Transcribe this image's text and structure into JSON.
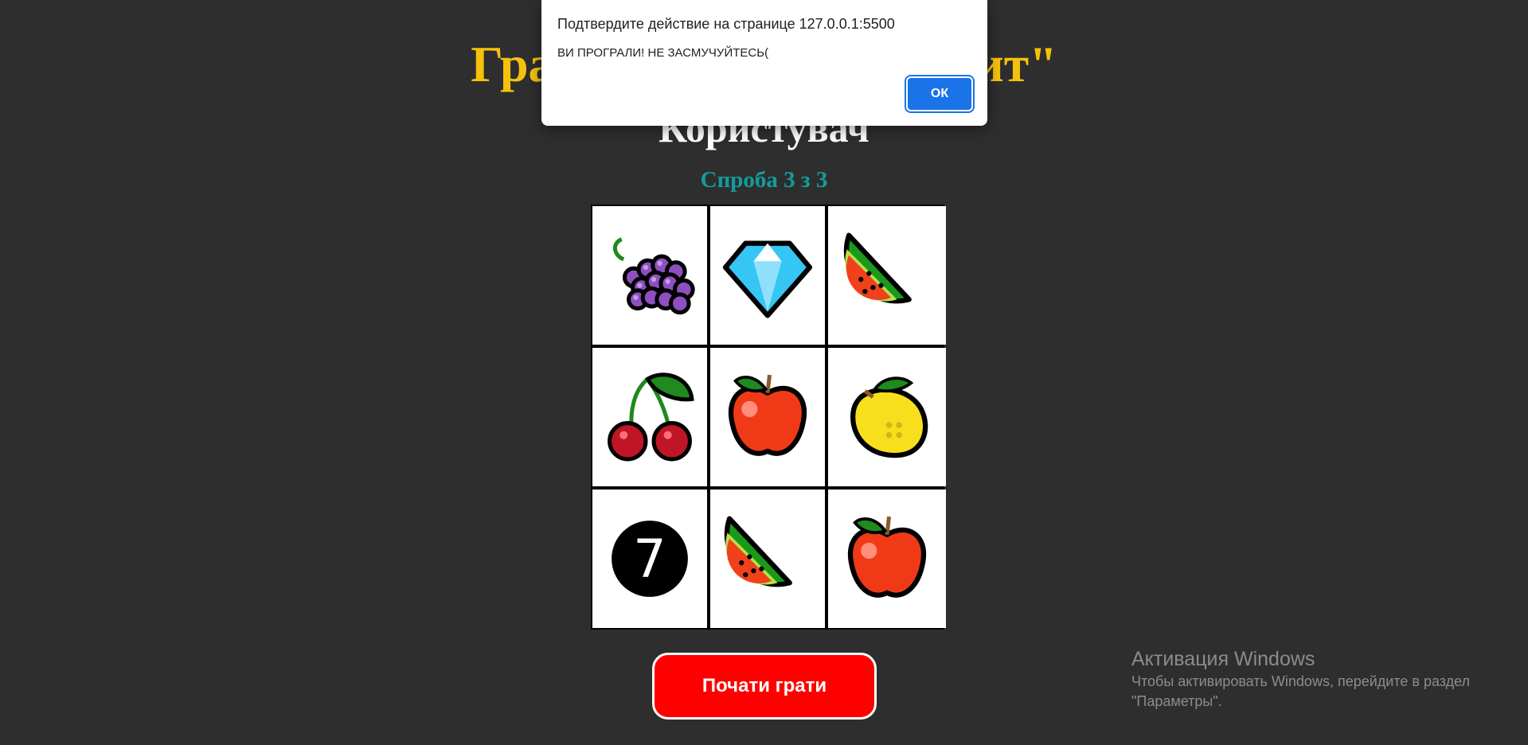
{
  "game": {
    "title": "Гра \"Однорукий бандит\"",
    "player_name": "Користувач",
    "attempt_text": "Спроба 3 з 3",
    "play_button_label": "Почати грати",
    "reels": [
      [
        "grapes-icon",
        "diamond-icon",
        "watermelon-icon"
      ],
      [
        "cherries-icon",
        "apple-icon",
        "lemon-icon"
      ],
      [
        "seven-icon",
        "watermelon-icon",
        "apple-icon"
      ]
    ],
    "seven_label": "7"
  },
  "dialog": {
    "title": "Подтвердите действие на странице 127.0.0.1:5500",
    "message": "ВИ ПРОГРАЛИ! НЕ ЗАСМУЧУЙТЕСЬ(",
    "ok_label": "ОК"
  },
  "windows_activation": {
    "title": "Активация Windows",
    "line1": "Чтобы активировать Windows, перейдите в раздел",
    "line2": "\"Параметры\"."
  },
  "colors": {
    "background": "#2e2e2e",
    "title": "#f4c20d",
    "attempt": "#159b9b",
    "play_button": "#ff0000",
    "ok_button": "#1a73e8"
  }
}
